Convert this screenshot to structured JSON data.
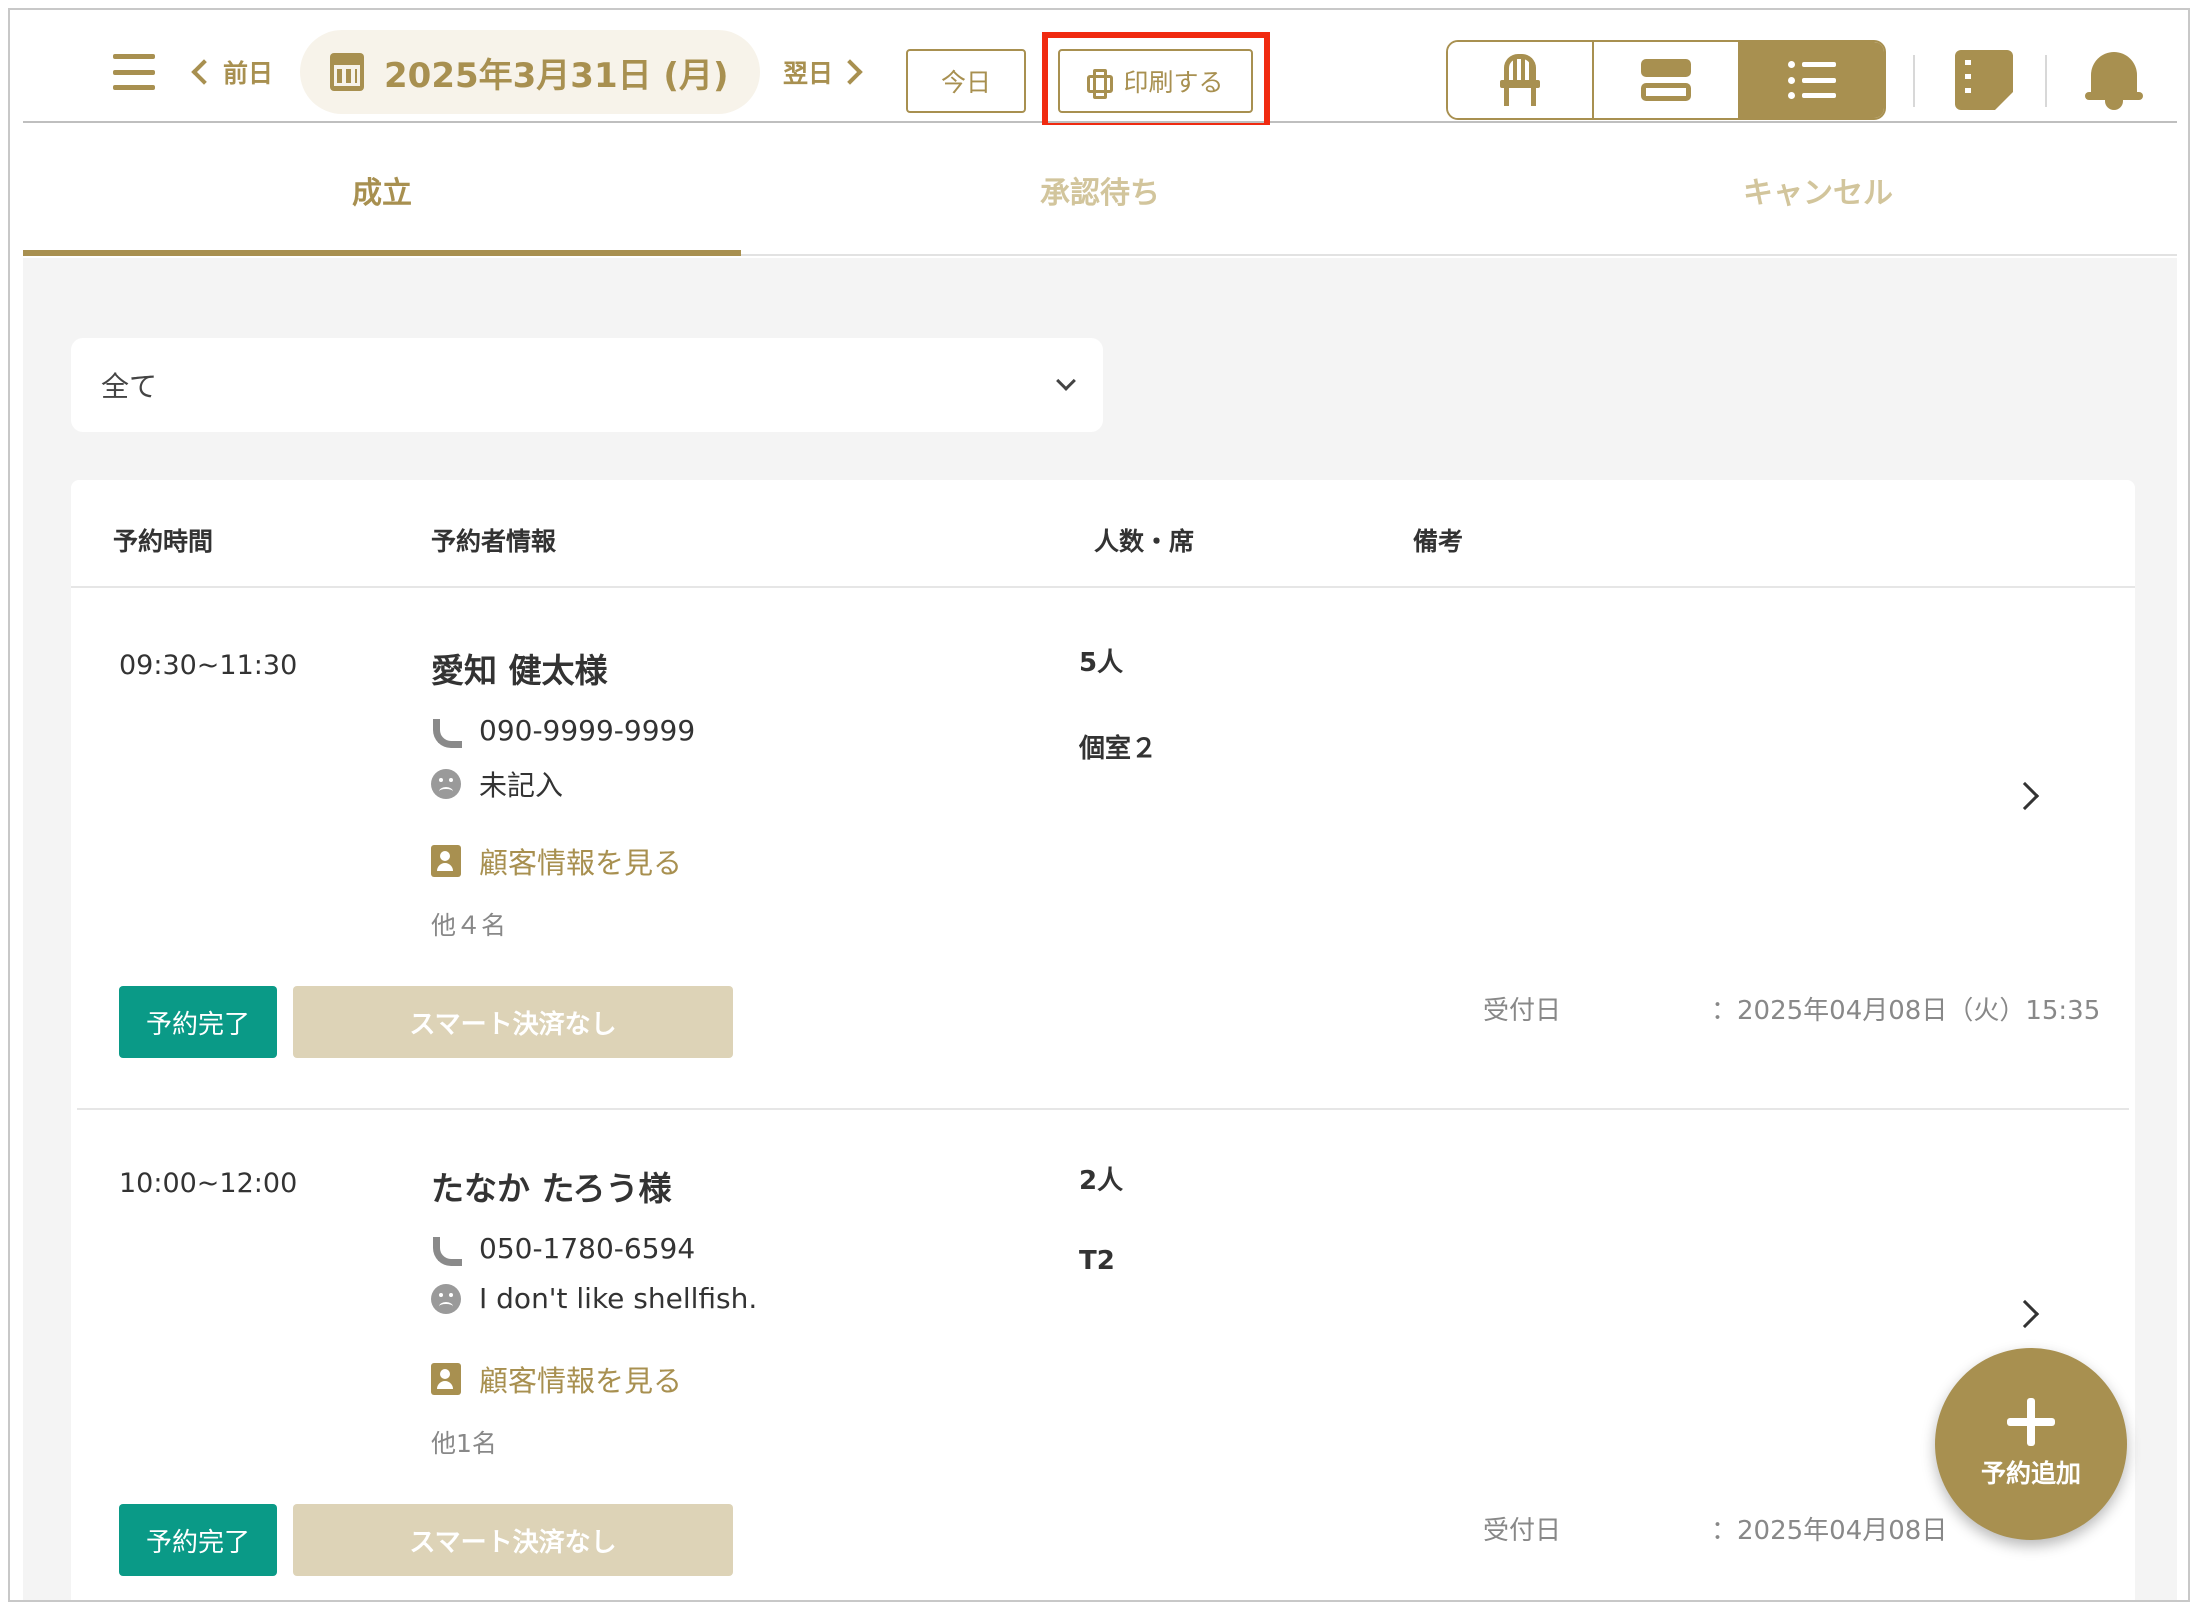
{
  "header": {
    "prev_label": "前日",
    "date": "2025年3月31日 (月)",
    "next_label": "翌日",
    "today_label": "今日",
    "print_label": "印刷する",
    "view_modes": [
      "seat-view-icon",
      "timeline-view-icon",
      "list-view-icon"
    ],
    "active_view": "list-view-icon"
  },
  "tabs": [
    {
      "label": "成立",
      "active": true
    },
    {
      "label": "承認待ち",
      "active": false
    },
    {
      "label": "キャンセル",
      "active": false
    }
  ],
  "filter": {
    "selected": "全て"
  },
  "table": {
    "headers": [
      "予約時間",
      "予約者情報",
      "人数・席",
      "備考"
    ],
    "rows": [
      {
        "time": "09:30~11:30",
        "name": "愛知 健太様",
        "phone": "090-9999-9999",
        "note": "未記入",
        "customer_link": "顧客情報を見る",
        "others": "他４名",
        "count": "5人",
        "seat": "個室２",
        "status": "予約完了",
        "payment": "スマート決済なし",
        "received_label": "受付日",
        "received_value": "：2025年04月08日（火）15:35"
      },
      {
        "time": "10:00~12:00",
        "name": "たなか たろう様",
        "phone": "050-1780-6594",
        "note": "I don't like shellfish.",
        "customer_link": "顧客情報を見る",
        "others": "他1名",
        "count": "2人",
        "seat": "T2",
        "status": "予約完了",
        "payment": "スマート決済なし",
        "received_label": "受付日",
        "received_value": "：2025年04月08日"
      }
    ]
  },
  "fab": {
    "label": "予約追加"
  },
  "colors": {
    "accent": "#a89050",
    "status": "#0a9a87",
    "highlight": "#f02a10"
  }
}
